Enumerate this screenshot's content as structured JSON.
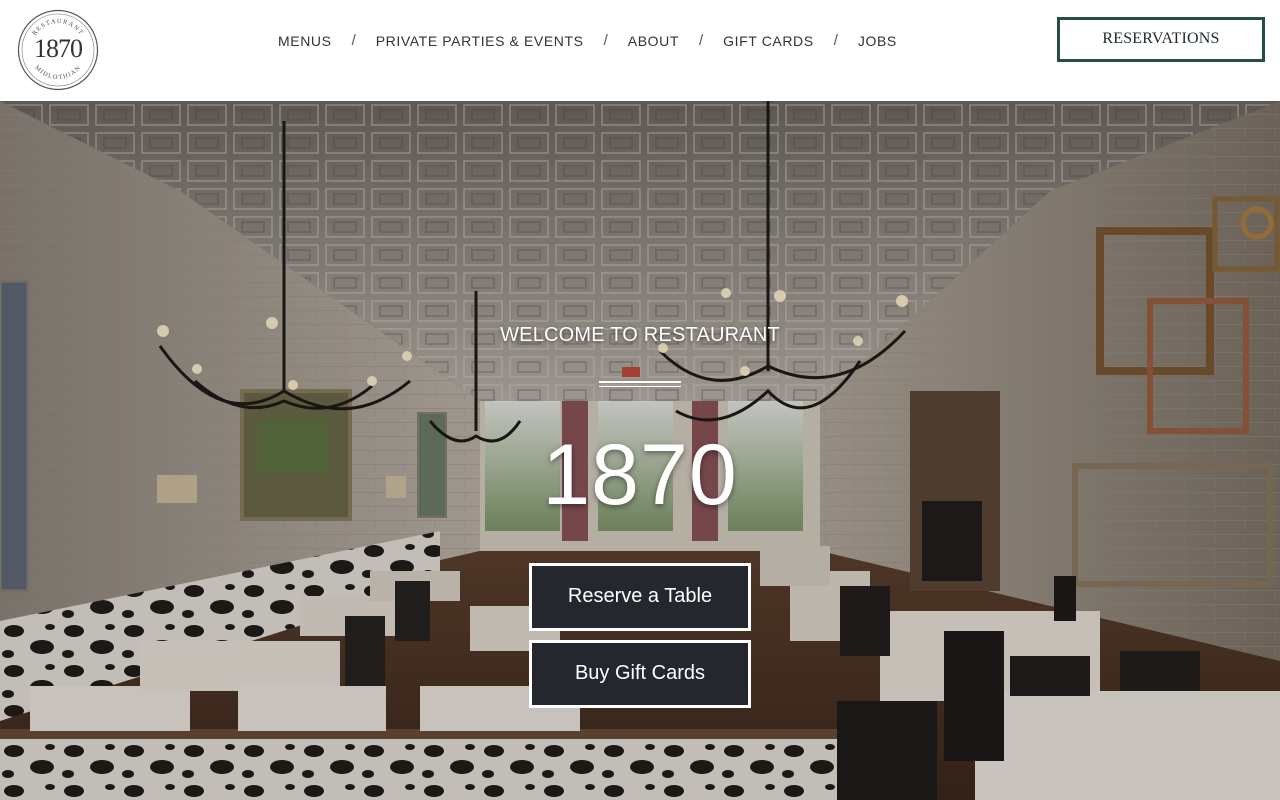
{
  "header": {
    "logo": {
      "text": "1870",
      "ring_top": "RESTAURANT",
      "ring_bottom": "MIDLOTHIAN"
    },
    "nav": [
      {
        "label": "MENUS"
      },
      {
        "label": "PRIVATE PARTIES & EVENTS"
      },
      {
        "label": "ABOUT"
      },
      {
        "label": "GIFT CARDS"
      },
      {
        "label": "JOBS"
      }
    ],
    "nav_separator": "/",
    "reservations_label": "RESERVATIONS",
    "accent_color": "#24513f"
  },
  "hero": {
    "welcome": "WELCOME TO RESTAURANT",
    "title": "1870",
    "buttons": {
      "reserve": "Reserve a Table",
      "gift": "Buy Gift Cards"
    },
    "button_color": "#24282e"
  }
}
